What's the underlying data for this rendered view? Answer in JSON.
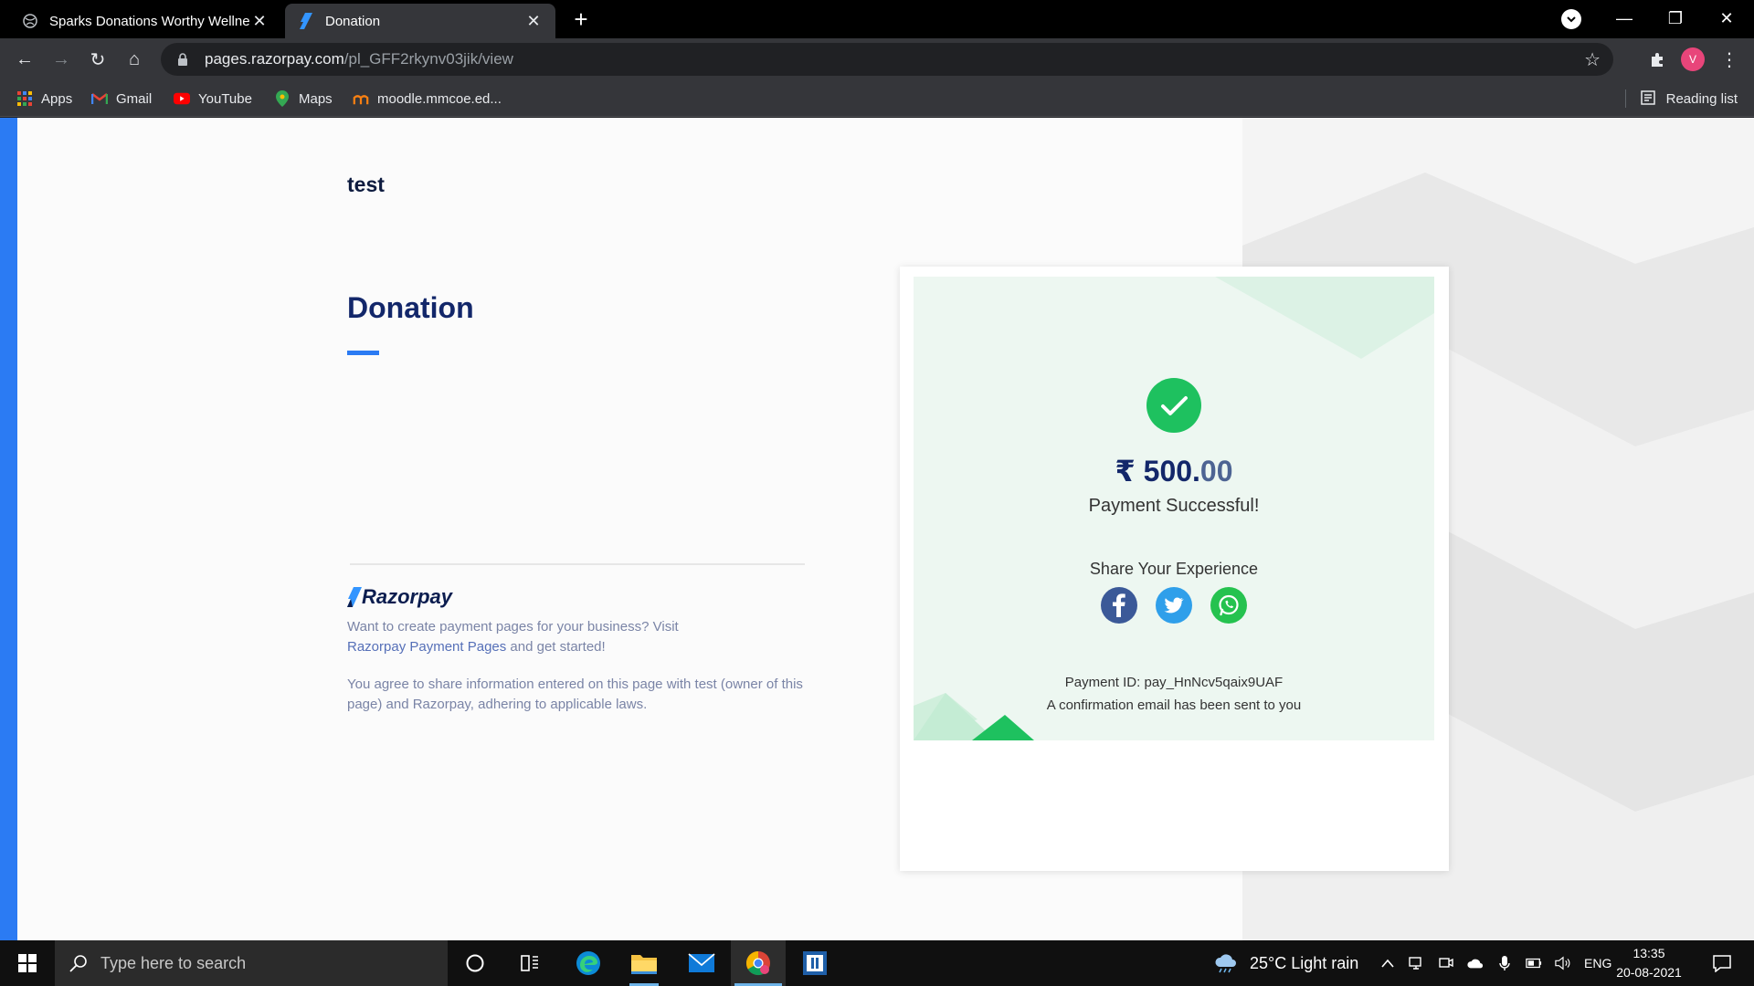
{
  "browser": {
    "tabs": [
      {
        "title": "Sparks Donations Worthy Wellne",
        "active": false
      },
      {
        "title": "Donation",
        "active": true
      }
    ],
    "url_host": "pages.razorpay.com",
    "url_path": "/pl_GFF2rkynv03jik/view",
    "avatar_letter": "V",
    "bookmarks": [
      {
        "label": "Apps",
        "icon": "apps-grid-icon"
      },
      {
        "label": "Gmail",
        "icon": "gmail-icon"
      },
      {
        "label": "YouTube",
        "icon": "youtube-icon"
      },
      {
        "label": "Maps",
        "icon": "maps-icon"
      },
      {
        "label": "moodle.mmcoe.ed...",
        "icon": "moodle-icon"
      }
    ],
    "reading_list": "Reading list"
  },
  "page": {
    "merchant_name": "test",
    "title": "Donation",
    "brand": "Razorpay",
    "promo_text": "Want to create payment pages for your business? Visit ",
    "promo_link": "Razorpay Payment Pages",
    "promo_suffix": " and get started!",
    "legal_text": "You agree to share information entered on this page with test (owner of this page) and Razorpay, adhering to applicable laws."
  },
  "receipt": {
    "currency_symbol": "₹",
    "amount_main": "500.",
    "amount_paise": "00",
    "status": "Payment Successful!",
    "share_title": "Share Your Experience",
    "share_icons": [
      "facebook-icon",
      "twitter-icon",
      "whatsapp-icon"
    ],
    "payment_id": "Payment ID: pay_HnNcv5qaix9UAF",
    "confirmation": "A confirmation email has been sent to you"
  },
  "colors": {
    "accent_blue": "#2b7bf3",
    "success_green": "#1ec15f",
    "title_navy": "#13276a",
    "card_tint": "#edf7f1"
  },
  "taskbar": {
    "search_placeholder": "Type here to search",
    "weather": "25°C  Light rain",
    "language": "ENG",
    "time": "13:35",
    "date": "20-08-2021"
  }
}
